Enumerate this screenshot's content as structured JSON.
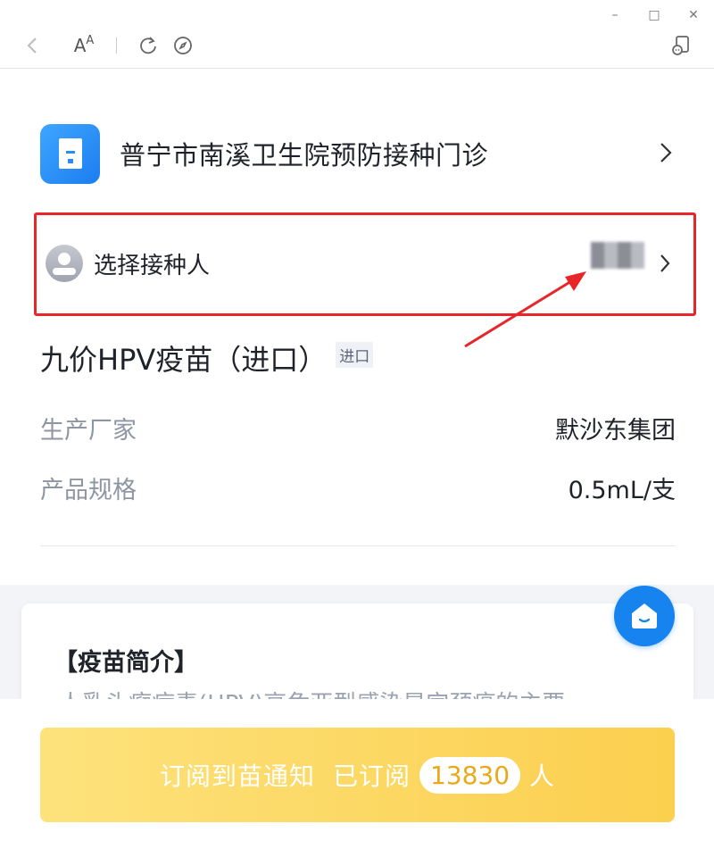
{
  "window": {
    "minimize_glyph": "–",
    "maximize_glyph": "□",
    "close_glyph": "✕"
  },
  "toolbar": {
    "font_size_label": "AA"
  },
  "clinic": {
    "name": "普宁市南溪卫生院预防接种门诊"
  },
  "recipient": {
    "label": "选择接种人"
  },
  "vaccine": {
    "name": "九价HPV疫苗（进口）",
    "tag": "进口",
    "specs": [
      {
        "label": "生产厂家",
        "value": "默沙东集团"
      },
      {
        "label": "产品规格",
        "value": "0.5mL/支"
      }
    ]
  },
  "intro": {
    "title": "【疫苗简介】",
    "text_preview": "人乳头瘤病毒(HPV)高危亚型感染是宫颈癌的主要"
  },
  "subscribe": {
    "label": "订阅到苗通知",
    "subscribed_prefix": "已订阅",
    "count": "13830",
    "suffix": "人"
  },
  "colors": {
    "accent_blue": "#1683ee",
    "highlight_red": "#e8262a",
    "button_yellow": "#fccf4e"
  }
}
